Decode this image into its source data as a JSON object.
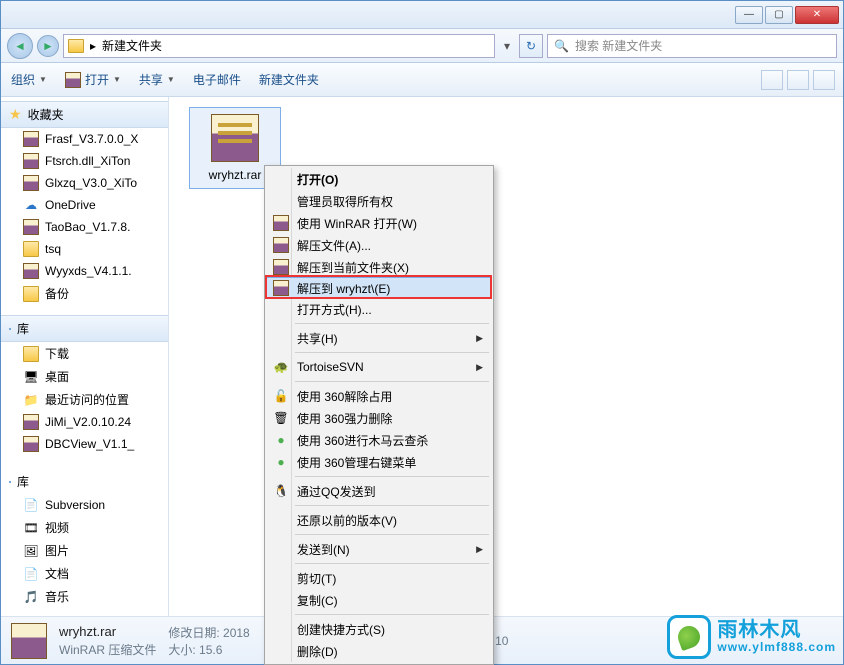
{
  "address": {
    "folder_name": "新建文件夹"
  },
  "search": {
    "placeholder": "搜索 新建文件夹"
  },
  "toolbar": {
    "organize": "组织",
    "open": "打开",
    "share": "共享",
    "email": "电子邮件",
    "new_folder": "新建文件夹"
  },
  "sidebar": {
    "favorites_label": "收藏夹",
    "items": [
      {
        "label": "Frasf_V3.7.0.0_X",
        "icon": "rar"
      },
      {
        "label": "Ftsrch.dll_XiTon",
        "icon": "rar"
      },
      {
        "label": "Glxzq_V3.0_XiTo",
        "icon": "rar"
      },
      {
        "label": "OneDrive",
        "icon": "cloud"
      },
      {
        "label": "TaoBao_V1.7.8.",
        "icon": "rar"
      },
      {
        "label": "tsq",
        "icon": "folder"
      },
      {
        "label": "Wyyxds_V4.1.1.",
        "icon": "rar"
      },
      {
        "label": "备份",
        "icon": "folder"
      }
    ],
    "libraries_label": "库",
    "library_items": [
      {
        "label": "下载",
        "icon": "folder"
      },
      {
        "label": "桌面",
        "icon": "desktop"
      },
      {
        "label": "最近访问的位置",
        "icon": "recent"
      },
      {
        "label": "JiMi_V2.0.10.24",
        "icon": "rar"
      },
      {
        "label": "DBCView_V1.1_",
        "icon": "rar"
      }
    ],
    "libs2_label": "库",
    "libs2": [
      {
        "label": "Subversion"
      },
      {
        "label": "视频"
      },
      {
        "label": "图片"
      },
      {
        "label": "文档"
      },
      {
        "label": "音乐"
      }
    ]
  },
  "file": {
    "name": "wryhzt.rar"
  },
  "context_menu": {
    "open": "打开(O)",
    "admin": "管理员取得所有权",
    "open_winrar": "使用 WinRAR 打开(W)",
    "extract_files": "解压文件(A)...",
    "extract_here": "解压到当前文件夹(X)",
    "extract_to": "解压到 wryhzt\\(E)",
    "open_with": "打开方式(H)...",
    "share": "共享(H)",
    "tortoise": "TortoiseSVN",
    "use_360_unlock": "使用 360解除占用",
    "use_360_force_del": "使用 360强力删除",
    "use_360_trojan": "使用 360进行木马云查杀",
    "use_360_menu": "使用 360管理右键菜单",
    "qq_send": "通过QQ发送到",
    "restore": "还原以前的版本(V)",
    "send_to": "发送到(N)",
    "cut": "剪切(T)",
    "copy": "复制(C)",
    "shortcut": "创建快捷方式(S)",
    "delete": "删除(D)"
  },
  "details": {
    "filename": "wryhzt.rar",
    "filetype": "WinRAR 压缩文件",
    "modified_label": "修改日期:",
    "modified_value": "2018",
    "modified_suffix": "02 17:10",
    "size_label": "大小:",
    "size_value": "15.6"
  },
  "watermark": {
    "line1": "雨林木风",
    "line2": "www.ylmf888.com"
  }
}
